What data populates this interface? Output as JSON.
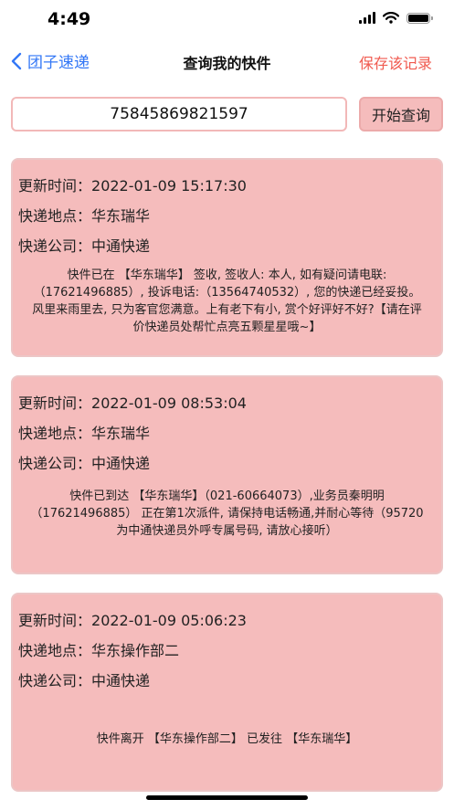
{
  "status_bar": {
    "time": "4:49"
  },
  "nav": {
    "back_label": "团子速递",
    "title": "查询我的快件",
    "save_label": "保存该记录"
  },
  "search": {
    "tracking_number": "75845869821597",
    "button_label": "开始查询"
  },
  "labels": {
    "updated": "更新时间：",
    "location": "快递地点：",
    "company": "快递公司："
  },
  "records": [
    {
      "time": "2022-01-09 15:17:30",
      "location": "华东瑞华",
      "company": "中通快递",
      "detail": "快件已在 【华东瑞华】 签收, 签收人: 本人, 如有疑问请电联:（17621496885）, 投诉电话:（13564740532）, 您的快递已经妥投。风里来雨里去, 只为客官您满意。上有老下有小, 赏个好评好不好?【请在评价快递员处帮忙点亮五颗星星哦~】"
    },
    {
      "time": "2022-01-09 08:53:04",
      "location": "华东瑞华",
      "company": "中通快递",
      "detail": "快件已到达 【华东瑞华】（021-60664073）,业务员秦明明（17621496885） 正在第1次派件, 请保持电话畅通,并耐心等待（95720为中通快递员外呼专属号码, 请放心接听）"
    },
    {
      "time": "2022-01-09 05:06:23",
      "location": "华东操作部二",
      "company": "中通快递",
      "detail": "快件离开 【华东操作部二】 已发往 【华东瑞华】"
    }
  ]
}
